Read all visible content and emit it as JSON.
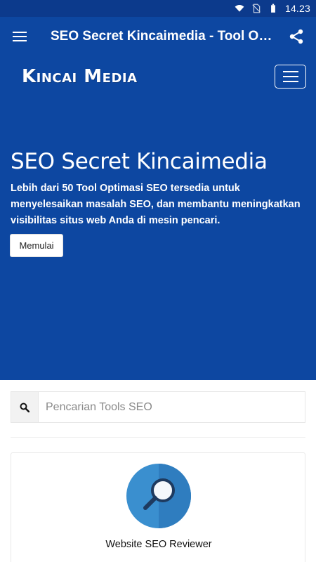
{
  "status_bar": {
    "time": "14.23",
    "icons": [
      "wifi-icon",
      "no-sim-icon",
      "battery-icon"
    ]
  },
  "app_bar": {
    "title": "SEO Secret Kincaimedia - Tool Optimasi SEO",
    "menu_icon": "hamburger-menu-icon",
    "share_icon": "share-icon"
  },
  "hero": {
    "brand": "Kincai Media",
    "title": "SEO Secret Kincaimedia",
    "description": "Lebih dari 50 Tool Optimasi SEO tersedia untuk menyelesaikan masalah SEO, dan membantu meningkatkan visibilitas situs web Anda di mesin pencari.",
    "button_label": "Memulai"
  },
  "search": {
    "placeholder": "Pencarian Tools SEO",
    "value": ""
  },
  "tools": [
    {
      "name": "Website SEO Reviewer",
      "icon": "magnifier-icon"
    }
  ],
  "colors": {
    "primary": "#0d47a1",
    "status_bar": "#0c3a8c",
    "tool_icon_bg": "#3a8fcf"
  }
}
